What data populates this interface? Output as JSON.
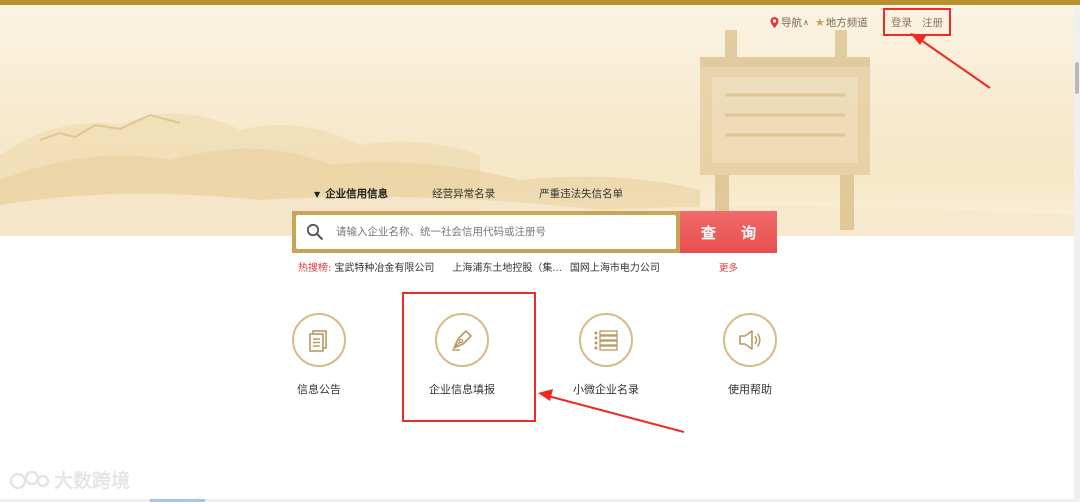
{
  "header": {
    "nav_label": "导航",
    "local_channel_label": "地方频道",
    "login_label": "登录",
    "register_label": "注册"
  },
  "tabs": [
    {
      "label": "企业信用信息",
      "active": true
    },
    {
      "label": "经营异常名录",
      "active": false
    },
    {
      "label": "严重违法失信名单",
      "active": false
    }
  ],
  "search": {
    "placeholder": "请输入企业名称、统一社会信用代码或注册号",
    "button_label": "查 询"
  },
  "hot_search": {
    "label": "热搜榜:",
    "items": [
      "宝武特种冶金有限公司",
      "上海浦东土地控股（集...",
      "国网上海市电力公司"
    ],
    "more_label": "更多"
  },
  "features": [
    {
      "label": "信息公告",
      "icon": "document-icon"
    },
    {
      "label": "企业信息填报",
      "icon": "pen-nib-icon"
    },
    {
      "label": "小微企业名录",
      "icon": "list-icon"
    },
    {
      "label": "使用帮助",
      "icon": "speaker-icon"
    }
  ],
  "watermark": {
    "text": "大数跨境"
  },
  "colors": {
    "gold": "#c9a55a",
    "search_button": "#e84f4f",
    "hot_red": "#e23a3a",
    "annotation_red": "#ee2b24"
  }
}
